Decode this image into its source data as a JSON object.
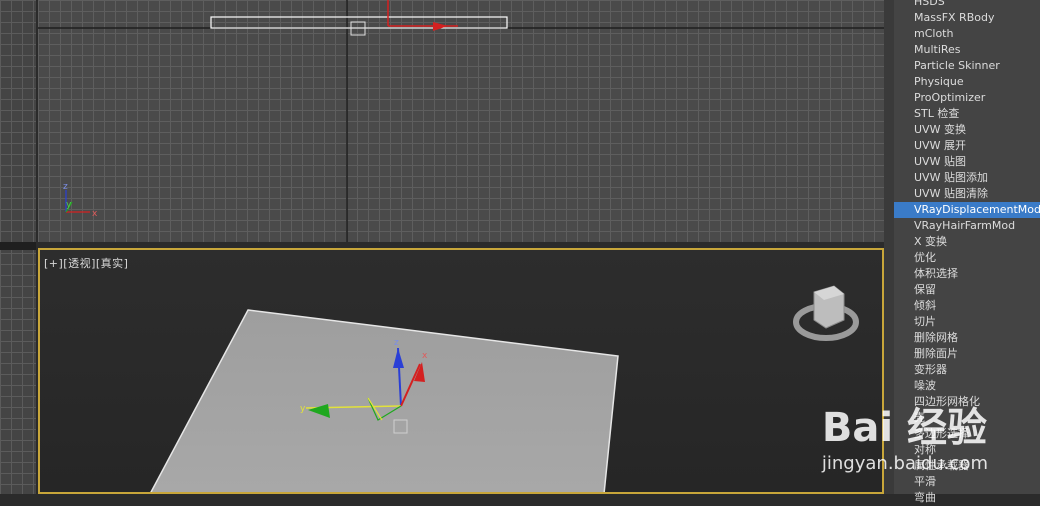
{
  "perspective_viewport": {
    "label": "[+][透视][真实]",
    "axis_labels": {
      "x": "x",
      "y": "y",
      "z": "z"
    }
  },
  "top_viewport": {
    "axis_labels": {
      "x": "x",
      "y": "y",
      "z": "z"
    }
  },
  "modifier_list": {
    "items": [
      "HSDS",
      "MassFX RBody",
      "mCloth",
      "MultiRes",
      "Particle Skinner",
      "Physique",
      "ProOptimizer",
      "STL 检查",
      "UVW 变换",
      "UVW 展开",
      "UVW 贴图",
      "UVW 贴图添加",
      "UVW 贴图清除",
      "VRayDisplacementMod",
      "VRayHairFarmMod",
      "X 变换",
      "优化",
      "体积选择",
      "保留",
      "倾斜",
      "切片",
      "删除网格",
      "删除面片",
      "变形器",
      "噪波",
      "四边形网格化",
      "壳",
      "多边形选择",
      "对称",
      "属性承载器",
      "平滑",
      "弯曲"
    ],
    "selected_index": 13
  },
  "watermark": {
    "brand": "Bai 经验",
    "url": "jingyan.baidu.com"
  },
  "colors": {
    "selection": "#3a7bc8",
    "active_viewport_border": "#c8a63a",
    "axis_x": "#d42020",
    "axis_y": "#1fa81f",
    "axis_z": "#2a3fd6"
  }
}
